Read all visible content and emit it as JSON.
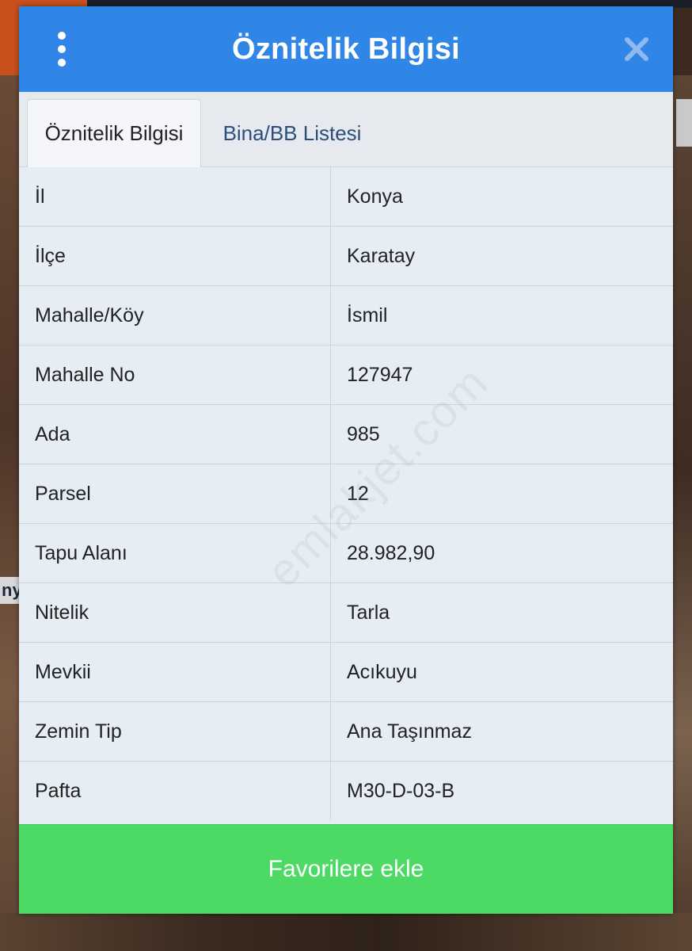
{
  "dialog": {
    "title": "Öznitelik Bilgisi"
  },
  "tabs": [
    {
      "label": "Öznitelik Bilgisi",
      "active": true
    },
    {
      "label": "Bina/BB Listesi",
      "active": false
    }
  ],
  "attributes": [
    {
      "key": "İl",
      "value": "Konya"
    },
    {
      "key": "İlçe",
      "value": "Karatay"
    },
    {
      "key": "Mahalle/Köy",
      "value": "İsmil"
    },
    {
      "key": "Mahalle No",
      "value": "127947"
    },
    {
      "key": "Ada",
      "value": "985"
    },
    {
      "key": "Parsel",
      "value": "12"
    },
    {
      "key": "Tapu Alanı",
      "value": "28.982,90"
    },
    {
      "key": "Nitelik",
      "value": "Tarla"
    },
    {
      "key": "Mevkii",
      "value": "Acıkuyu"
    },
    {
      "key": "Zemin Tip",
      "value": "Ana Taşınmaz"
    },
    {
      "key": "Pafta",
      "value": "M30-D-03-B"
    }
  ],
  "footer": {
    "add_favorite_label": "Favorilere ekle"
  },
  "watermark": "emlakjet.com",
  "background": {
    "partial_text": "ny"
  },
  "colors": {
    "header": "#2f86e6",
    "footer_button": "#4cd964",
    "table_bg": "#e6edf5"
  },
  "icons": {
    "menu": "more-vertical-icon",
    "close": "close-icon"
  }
}
